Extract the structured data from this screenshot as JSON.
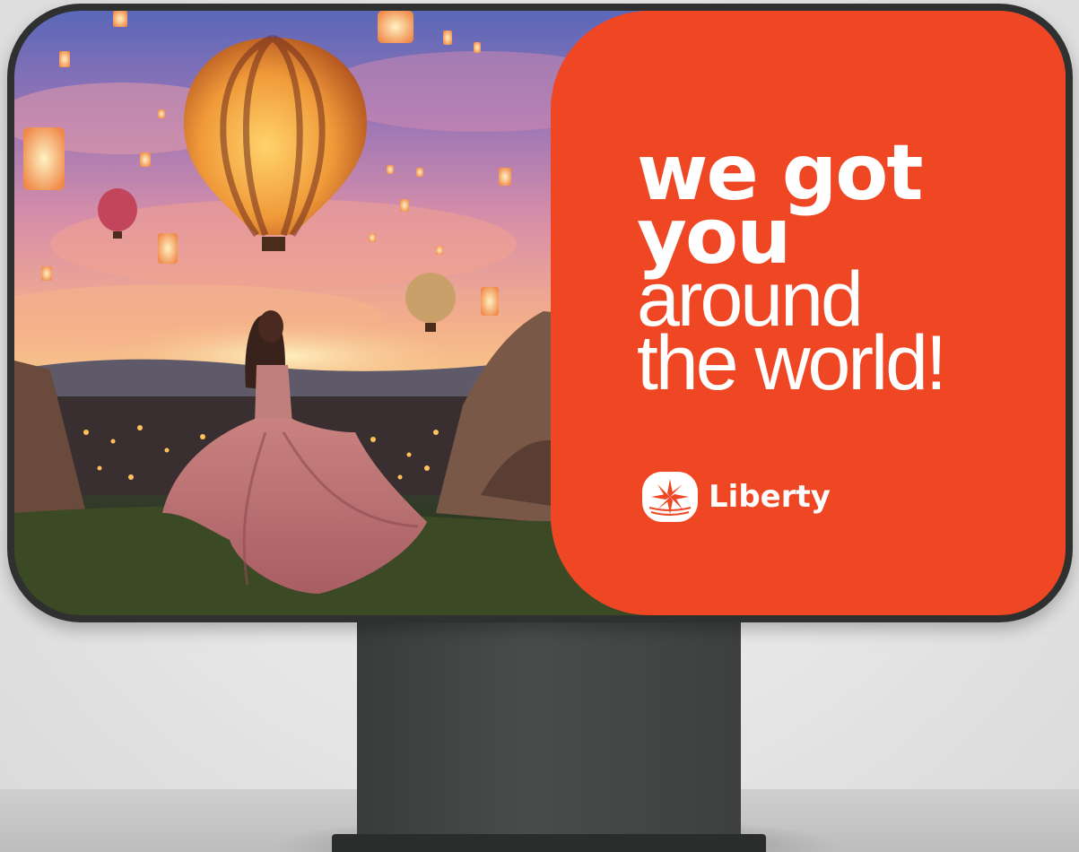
{
  "billboard": {
    "headline_line1": "we got",
    "headline_line2": "you",
    "headline_line3": "around",
    "headline_line4": "the world!",
    "brand_name": "Liberty",
    "panel_color": "#ef4623"
  },
  "scene": {
    "icons": [
      "hot-air-balloon-icon",
      "sky-lantern-icon",
      "woman-in-dress-figure",
      "rock-formation"
    ]
  }
}
